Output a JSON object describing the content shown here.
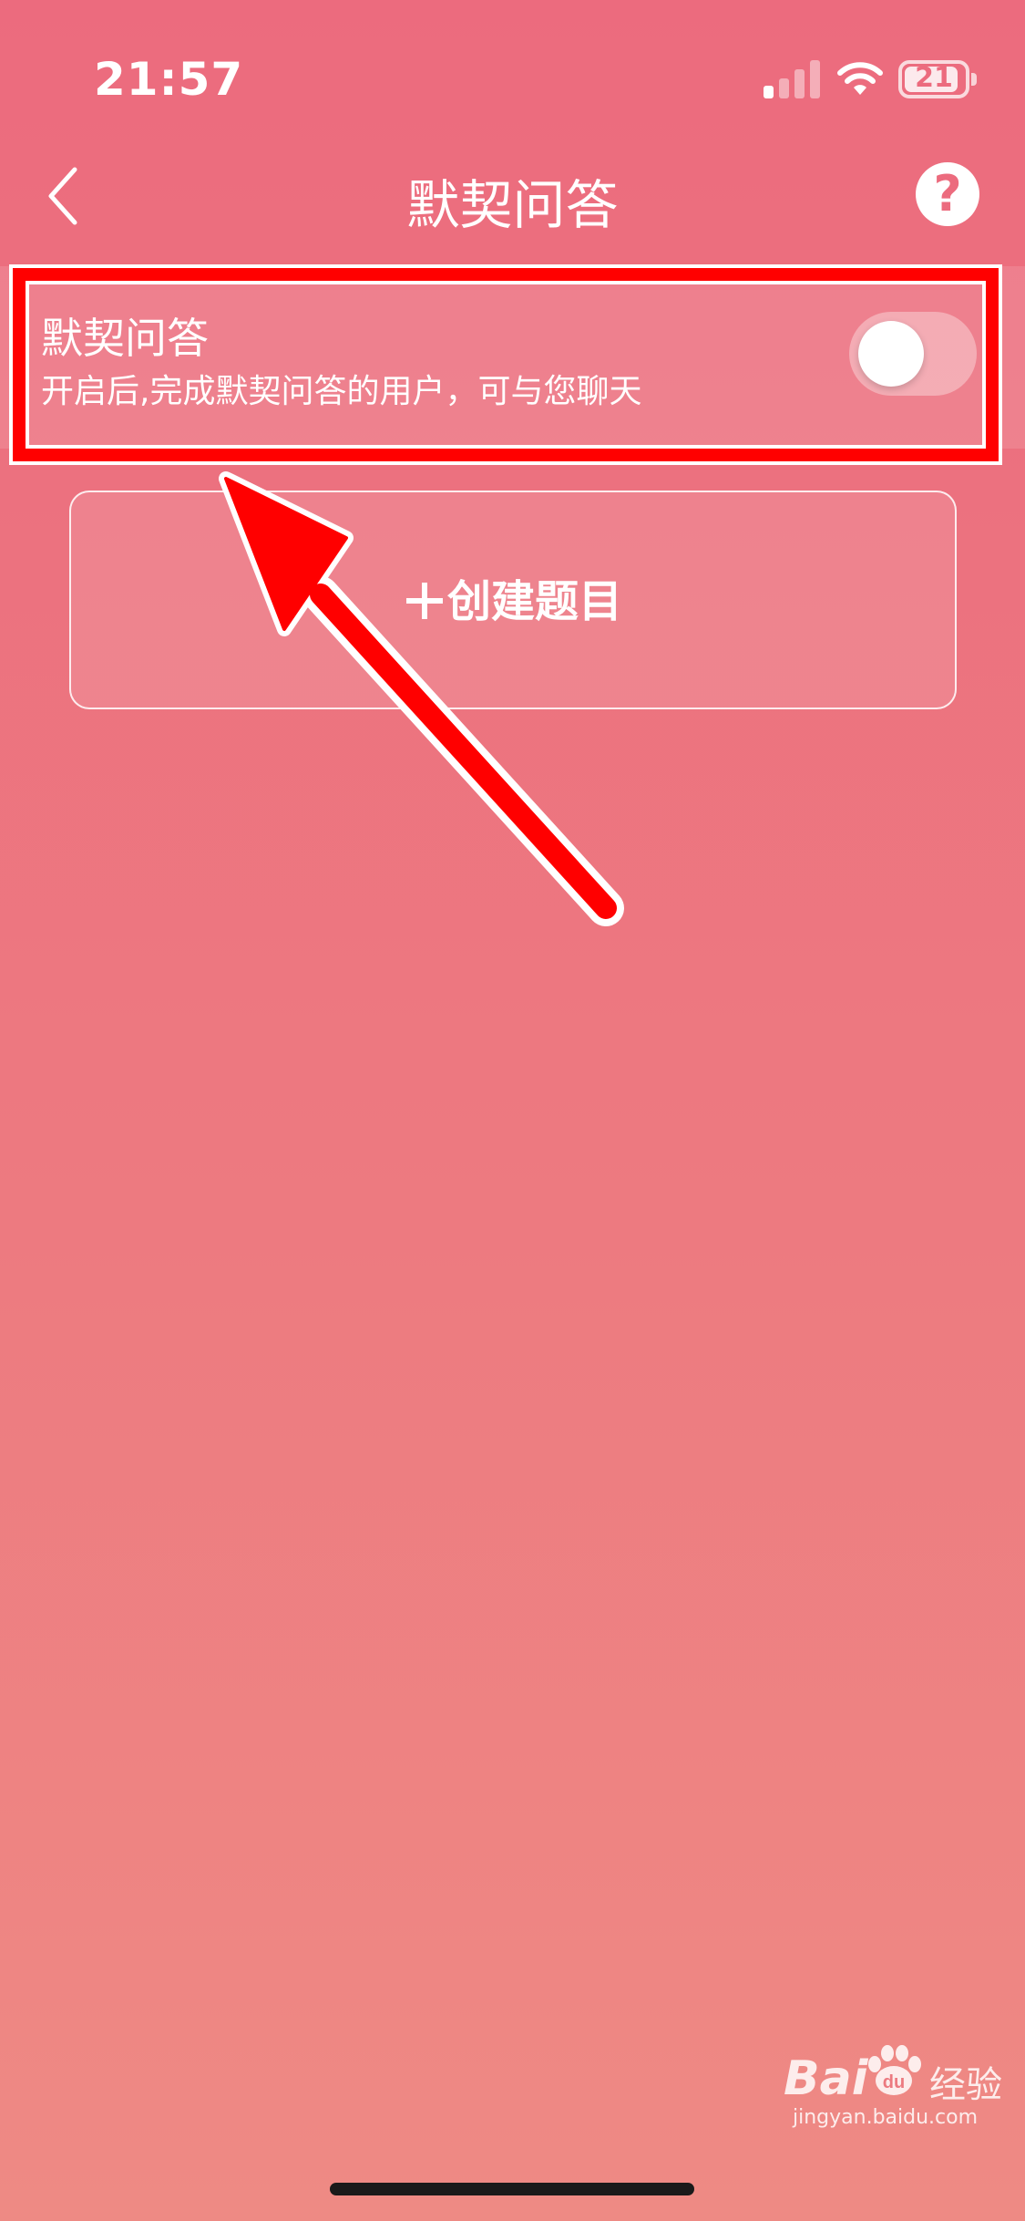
{
  "status_bar": {
    "time": "21:57",
    "battery": "21"
  },
  "nav": {
    "title": "默契问答"
  },
  "setting": {
    "title": "默契问答",
    "description": "开启后,完成默契问答的用户，可与您聊天",
    "toggle_on": false
  },
  "create_button": {
    "label": "创建题目"
  },
  "watermark": {
    "brand": "Bai",
    "brand_suffix": "du",
    "cn": "经验",
    "url": "jingyan.baidu.com"
  },
  "colors": {
    "background_top": "#ec6b7e",
    "background_bottom": "#ee8a84",
    "annotation": "#ff0000"
  },
  "icons": [
    "back-chevron-icon",
    "help-icon",
    "signal-icon",
    "wifi-icon",
    "battery-icon",
    "plus-icon",
    "baidu-paw-icon"
  ]
}
